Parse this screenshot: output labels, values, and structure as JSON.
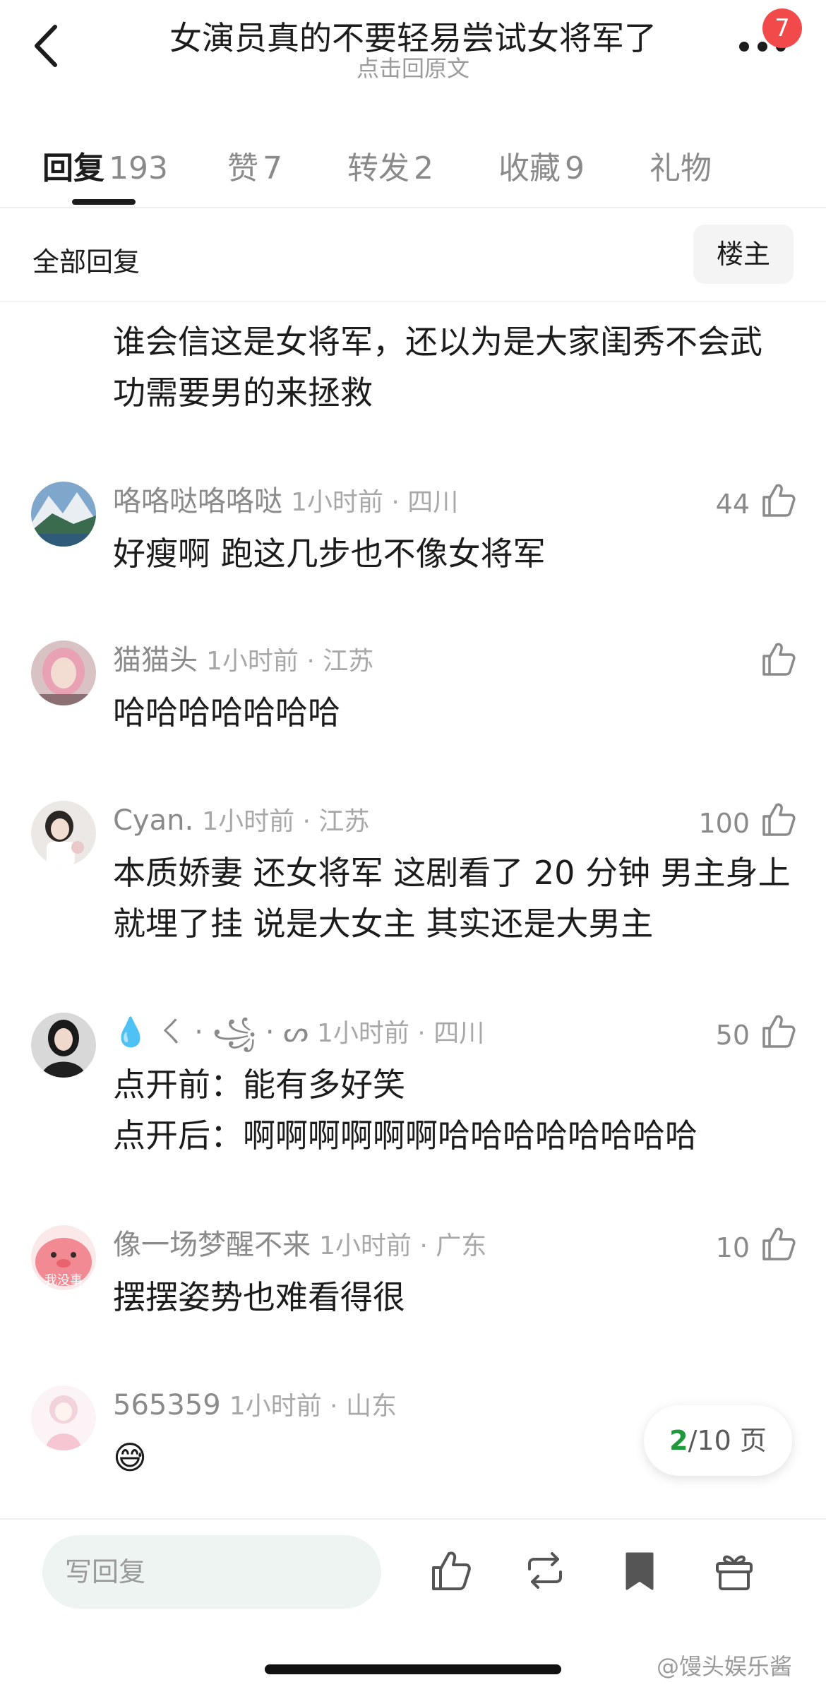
{
  "header": {
    "title": "女演员真的不要轻易尝试女将军了",
    "subtitle": "点击回原文",
    "badge_count": "7",
    "back_icon": "chevron-left-icon",
    "more_icon": "more-dots-icon"
  },
  "tabs": [
    {
      "label": "回复",
      "count": "193",
      "active": true
    },
    {
      "label": "赞",
      "count": "7"
    },
    {
      "label": "转发",
      "count": "2"
    },
    {
      "label": "收藏",
      "count": "9"
    },
    {
      "label": "礼物",
      "count": ""
    }
  ],
  "filter": {
    "label": "全部回复",
    "owner_button": "楼主"
  },
  "partial_comment": {
    "text": "谁会信这是女将军，还以为是大家闺秀不会武功需要男的来拯救"
  },
  "comments": [
    {
      "username": "咯咯哒咯咯哒",
      "time": "1小时前 · 四川",
      "likes": "44",
      "text": "好瘦啊 跑这几步也不像女将军"
    },
    {
      "username": "猫猫头",
      "time": "1小时前 · 江苏",
      "likes": "",
      "text": "哈哈哈哈哈哈哈"
    },
    {
      "username": "Cyan.",
      "time": "1小时前 · 江苏",
      "likes": "100",
      "text": "本质娇妻  还女将军  这剧看了 20 分钟 男主身上就埋了挂   说是大女主  其实还是大男主"
    },
    {
      "username": "💧 ㄑ · ꧁ · ᔕ",
      "time": "1小时前 · 四川",
      "likes": "50",
      "text_lines": [
        "点开前：能有多好笑",
        "点开后：啊啊啊啊啊啊哈哈哈哈哈哈哈哈"
      ]
    },
    {
      "username": "像一场梦醒不来",
      "time": "1小时前 · 广东",
      "likes": "10",
      "text": "摆摆姿势也难看得很",
      "avatar_text": "我没事"
    },
    {
      "username": "565359",
      "time": "1小时前 · 山东",
      "likes": "",
      "text": "😅"
    }
  ],
  "pagination": {
    "current": "2",
    "total": "/10 页"
  },
  "bottom_bar": {
    "reply_placeholder": "写回复",
    "icons": [
      "thumbs-up-icon",
      "repost-icon",
      "bookmark-icon",
      "gift-icon"
    ]
  },
  "watermark": "@馒头娱乐酱",
  "colors": {
    "accent_green": "#1e9a3c",
    "badge_red": "#f24a4a"
  }
}
